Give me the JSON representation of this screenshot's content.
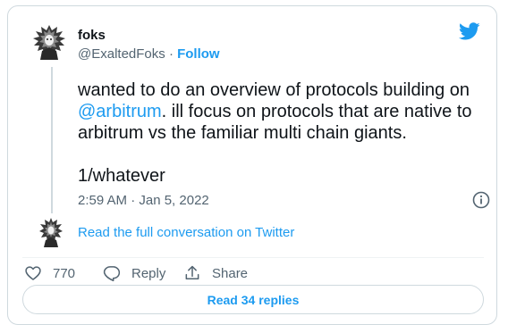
{
  "author": {
    "name": "foks",
    "handle": "@ExaltedFoks",
    "separator": "·",
    "follow_label": "Follow",
    "avatar_icon": "ornate-figure-avatar"
  },
  "tweet": {
    "text_before_mention": "wanted to do an overview of protocols building on ",
    "mention": "@arbitrum",
    "text_after_mention": ". ill focus on protocols that are native to arbitrum vs the familiar multi chain giants.",
    "second_paragraph": "1/whatever",
    "timestamp": "2:59 AM · Jan 5, 2022"
  },
  "conversation_link": "Read the full conversation on Twitter",
  "actions": {
    "like_count": "770",
    "reply_label": "Reply",
    "share_label": "Share"
  },
  "read_replies_label": "Read 34 replies",
  "colors": {
    "accent": "#1d9bf0",
    "text": "#0f1419",
    "muted": "#536471",
    "border": "#cfd9de"
  },
  "icons": {
    "brand": "twitter-bird-icon",
    "info": "info-icon",
    "like": "heart-icon",
    "reply": "speech-bubble-icon",
    "share": "share-arrow-icon"
  }
}
